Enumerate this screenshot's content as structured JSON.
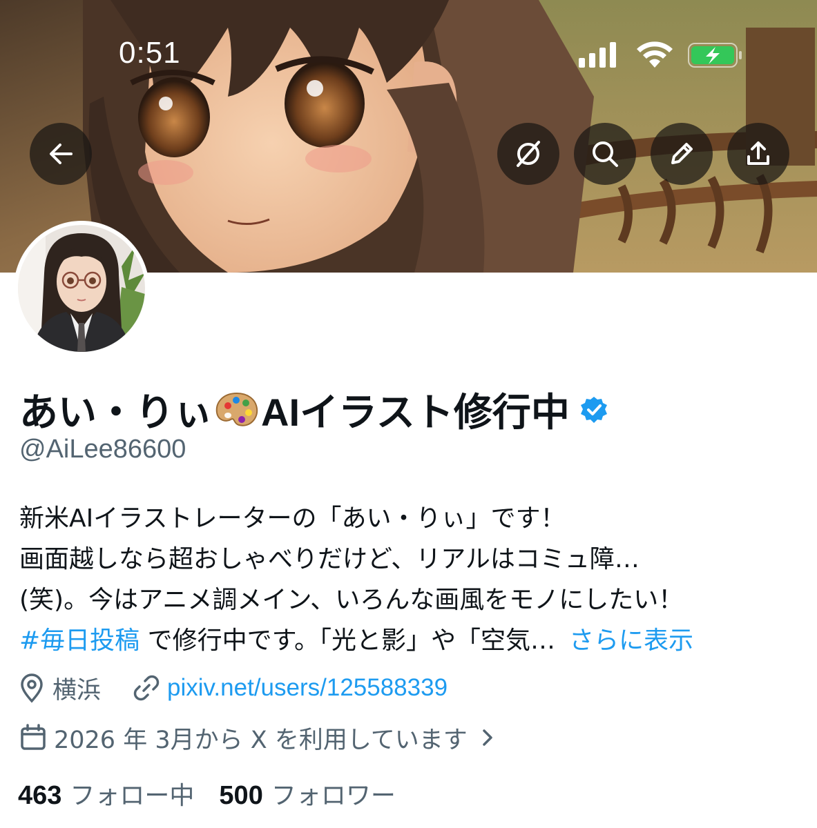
{
  "status_bar": {
    "time": "0:51"
  },
  "header_buttons": {
    "back": "back-arrow-icon",
    "grok": "grok-icon",
    "search": "search-icon",
    "edit": "pencil-icon",
    "share": "share-icon"
  },
  "profile": {
    "name_pre": "あい・りぃ",
    "name_post": "AIイラスト修行中",
    "handle": "@AiLee86600",
    "verified_color": "#1d9bf0"
  },
  "bio": {
    "line1": "新米AIイラストレーターの「あい・りぃ」です！",
    "line2": "画面越しなら超おしゃべりだけど、リアルはコミュ障…",
    "line3": "(笑)。今はアニメ調メイン、いろんな画風をモノにしたい！",
    "hashtag": "#毎日投稿",
    "line4_rest": " で修行中です。「光と影」や「空気…",
    "show_more": "さらに表示"
  },
  "meta": {
    "location": "横浜",
    "link": "pixiv.net/users/125588339",
    "joined": "2026 年 3月から X を利用しています"
  },
  "stats": {
    "following_count": "463",
    "following_label": "フォロー中",
    "followers_count": "500",
    "followers_label": "フォロワー"
  },
  "colors": {
    "link": "#1d9bf0",
    "secondary_text": "#536471",
    "primary_text": "#0f1419"
  }
}
